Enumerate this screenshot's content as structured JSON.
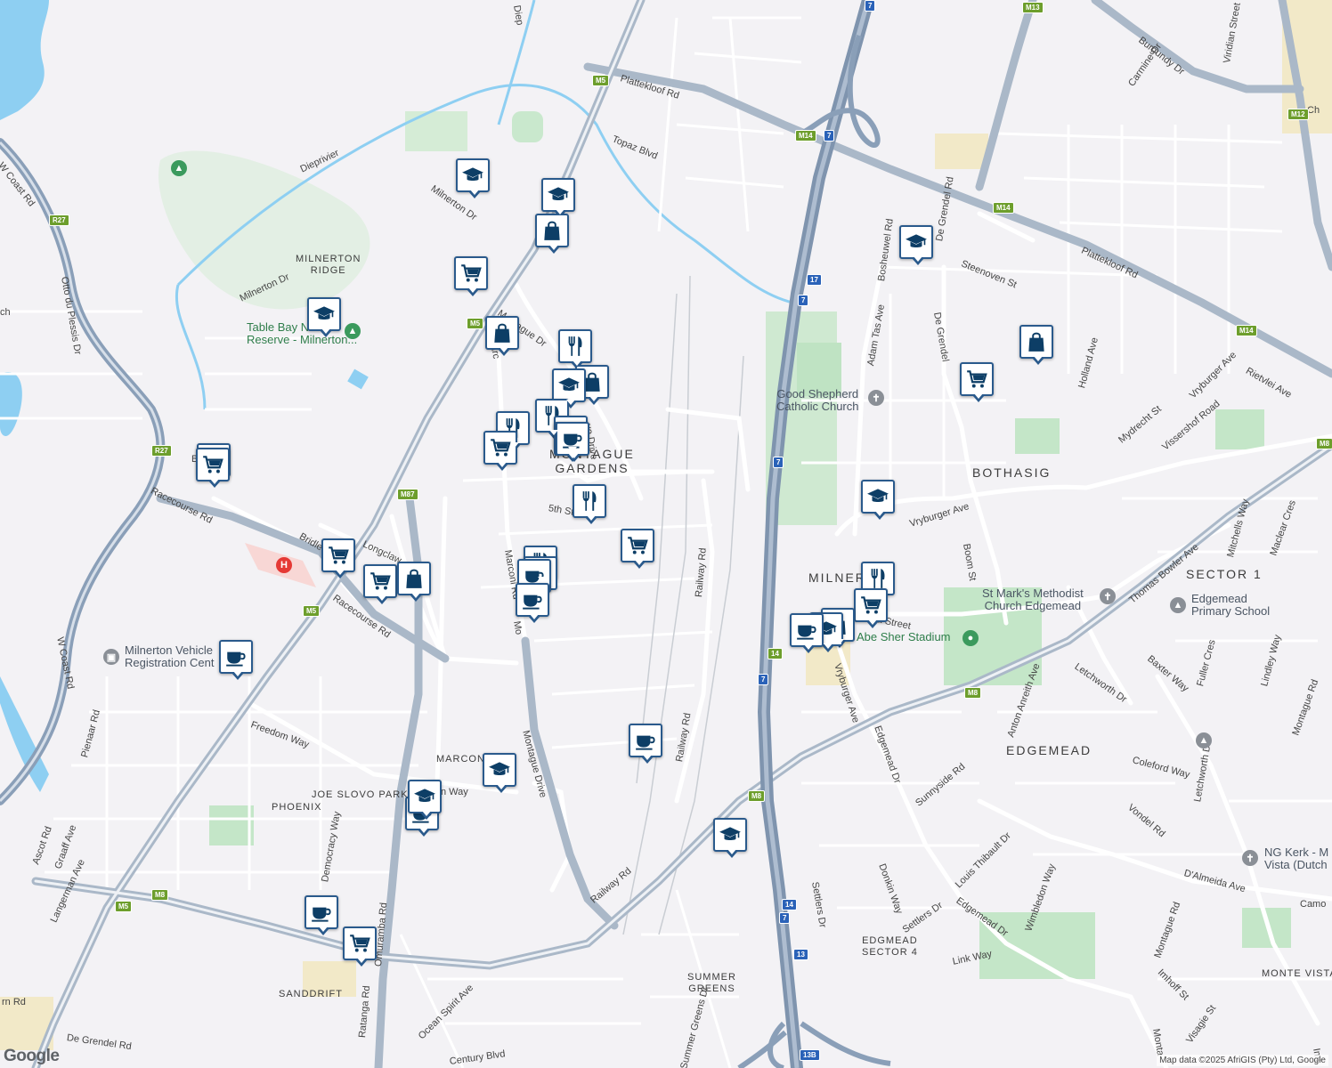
{
  "map": {
    "areas": [
      {
        "id": "montague-gardens",
        "line1": "MONTAGUE",
        "line2": "GARDENS"
      },
      {
        "id": "bothasig",
        "line1": "BOTHASIG",
        "line2": ""
      },
      {
        "id": "milnerton",
        "line1": "MILNERTON",
        "line2": ""
      },
      {
        "id": "edgemead",
        "line1": "EDGEMEAD",
        "line2": ""
      },
      {
        "id": "sector-1",
        "line1": "SECTOR 1",
        "line2": ""
      },
      {
        "id": "milnerton-ridge",
        "line1": "MILNERTON",
        "line2": "RIDGE"
      },
      {
        "id": "phoenix",
        "line1": "PHOENIX",
        "line2": ""
      },
      {
        "id": "joe-slovo-park",
        "line1": "JOE SLOVO PARK",
        "line2": ""
      },
      {
        "id": "marconi-beam",
        "line1": "MARCONI B",
        "line2": ""
      },
      {
        "id": "sanddrift",
        "line1": "SANDDRIFT",
        "line2": ""
      },
      {
        "id": "summer-greens",
        "line1": "SUMMER",
        "line2": "GREENS"
      },
      {
        "id": "edgmead-sector-4",
        "line1": "EDGMEAD",
        "line2": "SECTOR 4"
      },
      {
        "id": "monte-vista",
        "line1": "MONTE VISTA",
        "line2": ""
      }
    ],
    "roads": [
      {
        "id": "plattekloof-rd-top",
        "text": "Plattekloof Rd"
      },
      {
        "id": "plattekloof-rd-right",
        "text": "Plattekloof Rd"
      },
      {
        "id": "topaz-blvd",
        "text": "Topaz Blvd"
      },
      {
        "id": "milnerton-dr-top",
        "text": "Milnerton Dr"
      },
      {
        "id": "milnerton-dr-left",
        "text": "Milnerton Dr"
      },
      {
        "id": "montague-dr-north",
        "text": "Montague Dr"
      },
      {
        "id": "montague-drive-south",
        "text": "Montague Drive"
      },
      {
        "id": "5th-st",
        "text": "5th St"
      },
      {
        "id": "racecourse-rd-left",
        "text": "Racecourse Rd"
      },
      {
        "id": "racecourse-rd-mid",
        "text": "Racecourse Rd"
      },
      {
        "id": "bridle",
        "text": "Bridle"
      },
      {
        "id": "longclaw",
        "text": "Longclaw"
      },
      {
        "id": "railway-rd-1",
        "text": "Railway Rd"
      },
      {
        "id": "railway-rd-2",
        "text": "Railway Rd"
      },
      {
        "id": "railway-rd-3",
        "text": "Railway Rd"
      },
      {
        "id": "freedom-way",
        "text": "Freedom Way"
      },
      {
        "id": "democracy-way",
        "text": "Democracy Way"
      },
      {
        "id": "omuramba-rd",
        "text": "Omuramba Rd"
      },
      {
        "id": "ratanga-rd",
        "text": "Ratanga Rd"
      },
      {
        "id": "pienaar-rd",
        "text": "Pienaar Rd"
      },
      {
        "id": "w-coast-rd",
        "text": "W Coast Rd"
      },
      {
        "id": "w-coast-rd-top",
        "text": "W Coast Rd"
      },
      {
        "id": "otto-du-plessis",
        "text": "Otto du Plessis Dr"
      },
      {
        "id": "ascot-rd",
        "text": "Ascot Rd"
      },
      {
        "id": "graaff-ave",
        "text": "Graaff Ave"
      },
      {
        "id": "langerman-ave",
        "text": "Langerman Ave"
      },
      {
        "id": "de-grendel-rd-bottom",
        "text": "De Grendel Rd"
      },
      {
        "id": "century-blvd",
        "text": "Century Blvd"
      },
      {
        "id": "ocean-spirit-ave",
        "text": "Ocean Spirit Ave"
      },
      {
        "id": "summer-greens-dr",
        "text": "Summer Greens Dr"
      },
      {
        "id": "vryburger-ave-1",
        "text": "Vryburger Ave"
      },
      {
        "id": "vryburger-ave-2",
        "text": "Vryburger Ave"
      },
      {
        "id": "vryburger-ave-3",
        "text": "Vryburger Ave"
      },
      {
        "id": "edgemead-dr-1",
        "text": "Edgemead Dr"
      },
      {
        "id": "edgemead-dr-2",
        "text": "Edgemead Dr"
      },
      {
        "id": "adam-tas-ave",
        "text": "Adam Tas Ave"
      },
      {
        "id": "bosheuwel-rd",
        "text": "Bosheuwel Rd"
      },
      {
        "id": "steenoven-st",
        "text": "Steenoven St"
      },
      {
        "id": "de-grendel-rd-1",
        "text": "De Grendel Rd"
      },
      {
        "id": "de-grendel-rd-2",
        "text": "De Grendel"
      },
      {
        "id": "boom-st",
        "text": "Boom St"
      },
      {
        "id": "holland-ave",
        "text": "Holland Ave"
      },
      {
        "id": "mydrecht-st",
        "text": "Mydrecht St"
      },
      {
        "id": "vissershof-road",
        "text": "Vissershof Road"
      },
      {
        "id": "rietvlei-ave",
        "text": "Rietvlei Ave"
      },
      {
        "id": "burgundy-dr",
        "text": "Burgundy Dr"
      },
      {
        "id": "carmine-dr",
        "text": "Carmine Dr"
      },
      {
        "id": "viridian-street",
        "text": "Viridian Street"
      },
      {
        "id": "thomas-bowler-ave",
        "text": "Thomas Bowler Ave"
      },
      {
        "id": "mitchells-way",
        "text": "Mitchells Way"
      },
      {
        "id": "maclear-cres",
        "text": "Maclear Cres"
      },
      {
        "id": "baxter-way",
        "text": "Baxter Way"
      },
      {
        "id": "fuller-cres",
        "text": "Fuller Cres"
      },
      {
        "id": "lindley-way",
        "text": "Lindley Way"
      },
      {
        "id": "letchworth-dr-1",
        "text": "Letchworth Dr"
      },
      {
        "id": "letchworth-dr-2",
        "text": "Letchworth Dr"
      },
      {
        "id": "anton-anreith-ave",
        "text": "Anton Anreith Ave"
      },
      {
        "id": "sunnyside-rd",
        "text": "Sunnyside Rd"
      },
      {
        "id": "coleford-way",
        "text": "Coleford Way"
      },
      {
        "id": "vondel-rd",
        "text": "Vondel Rd"
      },
      {
        "id": "louis-thibault-dr",
        "text": "Louis Thibault Dr"
      },
      {
        "id": "wimbledon-way",
        "text": "Wimbledon Way"
      },
      {
        "id": "donkin-way",
        "text": "Donkin Way"
      },
      {
        "id": "settlers-dr-1",
        "text": "Settlers Dr"
      },
      {
        "id": "settlers-dr-2",
        "text": "Settlers Dr"
      },
      {
        "id": "d-almeida-ave",
        "text": "D'Almeida Ave"
      },
      {
        "id": "link-way",
        "text": "Link Way"
      },
      {
        "id": "montague-rd",
        "text": "Montague Rd"
      },
      {
        "id": "montague-rd-2",
        "text": "Montague Rd"
      },
      {
        "id": "imhoff-st",
        "text": "Imhoff St"
      },
      {
        "id": "visagie-st",
        "text": "Visagie St"
      },
      {
        "id": "marconi-rd",
        "text": "Marconi Rd"
      },
      {
        "id": "marconi",
        "text": "Marc"
      },
      {
        "id": "mo",
        "text": "Mo"
      },
      {
        "id": "street-a",
        "text": "a Street"
      },
      {
        "id": "diep",
        "text": "Diep"
      },
      {
        "id": "diepriv",
        "text": "Dieprivier"
      },
      {
        "id": "ch",
        "text": "Ch"
      },
      {
        "id": "rn-rd",
        "text": "rn Rd"
      },
      {
        "id": "mont",
        "text": "Monta"
      },
      {
        "id": "imt",
        "text": "Imt"
      },
      {
        "id": "camo",
        "text": "Camo"
      },
      {
        "id": "bri",
        "text": "B"
      },
      {
        "id": "ncs",
        "text": "ch"
      },
      {
        "id": "ra-way",
        "text": "n Way"
      },
      {
        "id": "de-drive",
        "text": "ue Drive"
      }
    ],
    "shields": [
      {
        "id": "m5-top",
        "text": "M5"
      },
      {
        "id": "m5-mid",
        "text": "M5"
      },
      {
        "id": "m5-left",
        "text": "M5"
      },
      {
        "id": "m5-bottom",
        "text": "M5"
      },
      {
        "id": "m14-top",
        "text": "M14"
      },
      {
        "id": "m14-right",
        "text": "M14"
      },
      {
        "id": "m14-east",
        "text": "M14"
      },
      {
        "id": "m13",
        "text": "M13"
      },
      {
        "id": "m12",
        "text": "M12"
      },
      {
        "id": "r27-top",
        "text": "R27"
      },
      {
        "id": "r27-mid",
        "text": "R27"
      },
      {
        "id": "m87",
        "text": "M87"
      },
      {
        "id": "m8-left",
        "text": "M8"
      },
      {
        "id": "m8-mid",
        "text": "M8"
      },
      {
        "id": "m8-right",
        "text": "M8"
      },
      {
        "id": "m8-east",
        "text": "M8"
      },
      {
        "id": "n7-1",
        "text": "7"
      },
      {
        "id": "n7-2",
        "text": "7"
      },
      {
        "id": "n7-3",
        "text": "7"
      },
      {
        "id": "n7-4",
        "text": "7"
      },
      {
        "id": "n7-5",
        "text": "7"
      },
      {
        "id": "n7-6",
        "text": "7"
      },
      {
        "id": "r17",
        "text": "17"
      },
      {
        "id": "r14-1",
        "text": "14"
      },
      {
        "id": "r14-2",
        "text": "14"
      },
      {
        "id": "r13",
        "text": "13"
      },
      {
        "id": "r13b",
        "text": "13B"
      }
    ],
    "pois": [
      {
        "id": "table-bay-reserve",
        "line1": "Table Bay N",
        "line2": "Reserve - Milnerton..."
      },
      {
        "id": "good-shepherd",
        "line1": "Good Shepherd",
        "line2": "Catholic Church"
      },
      {
        "id": "st-marks",
        "line1": "St Mark's Methodist",
        "line2": "Church Edgemead"
      },
      {
        "id": "edgemead-primary",
        "line1": "Edgemead",
        "line2": "Primary School"
      },
      {
        "id": "abe-sher-stadium",
        "line1": "Abe Sher Stadium",
        "line2": ""
      },
      {
        "id": "milnerton-vehicle",
        "line1": "Milnerton Vehicle",
        "line2": "Registration Cent"
      },
      {
        "id": "ng-kerk",
        "line1": "NG Kerk - M",
        "line2": "Vista (Dutch"
      }
    ],
    "markers": [
      {
        "id": "m01",
        "type": "school"
      },
      {
        "id": "m02",
        "type": "school"
      },
      {
        "id": "m03",
        "type": "shopping"
      },
      {
        "id": "m04",
        "type": "grocery"
      },
      {
        "id": "m05",
        "type": "school"
      },
      {
        "id": "m06",
        "type": "shopping"
      },
      {
        "id": "m07",
        "type": "restaurant"
      },
      {
        "id": "m08",
        "type": "shopping"
      },
      {
        "id": "m09",
        "type": "school"
      },
      {
        "id": "m10",
        "type": "restaurant"
      },
      {
        "id": "m11",
        "type": "restaurant"
      },
      {
        "id": "m12",
        "type": "cafe"
      },
      {
        "id": "m13",
        "type": "cafe"
      },
      {
        "id": "m14",
        "type": "grocery"
      },
      {
        "id": "m15",
        "type": "cafe"
      },
      {
        "id": "m16",
        "type": "restaurant"
      },
      {
        "id": "m17",
        "type": "grocery"
      },
      {
        "id": "m18",
        "type": "grocery"
      },
      {
        "id": "m19",
        "type": "grocery"
      },
      {
        "id": "m20",
        "type": "shopping"
      },
      {
        "id": "m21",
        "type": "restaurant"
      },
      {
        "id": "m22",
        "type": "shopping"
      },
      {
        "id": "m23",
        "type": "cafe"
      },
      {
        "id": "m24",
        "type": "cafe"
      },
      {
        "id": "m25",
        "type": "cafe"
      },
      {
        "id": "m26",
        "type": "grocery"
      },
      {
        "id": "m27",
        "type": "grocery"
      },
      {
        "id": "m28",
        "type": "cafe"
      },
      {
        "id": "m29",
        "type": "school"
      },
      {
        "id": "m30",
        "type": "cafe"
      },
      {
        "id": "m31",
        "type": "cafe"
      },
      {
        "id": "m32",
        "type": "grocery"
      },
      {
        "id": "m33",
        "type": "school"
      },
      {
        "id": "m34",
        "type": "school"
      },
      {
        "id": "m35",
        "type": "school"
      },
      {
        "id": "m36",
        "type": "shopping"
      },
      {
        "id": "m37",
        "type": "grocery"
      },
      {
        "id": "m38",
        "type": "school"
      },
      {
        "id": "m39",
        "type": "restaurant"
      },
      {
        "id": "m40",
        "type": "grocery"
      },
      {
        "id": "m41",
        "type": "shopping"
      },
      {
        "id": "m42",
        "type": "school"
      },
      {
        "id": "m43",
        "type": "cafe"
      }
    ],
    "logo": "Google",
    "attribution": "Map data ©2025 AfriGIS (Pty) Ltd, Google"
  }
}
